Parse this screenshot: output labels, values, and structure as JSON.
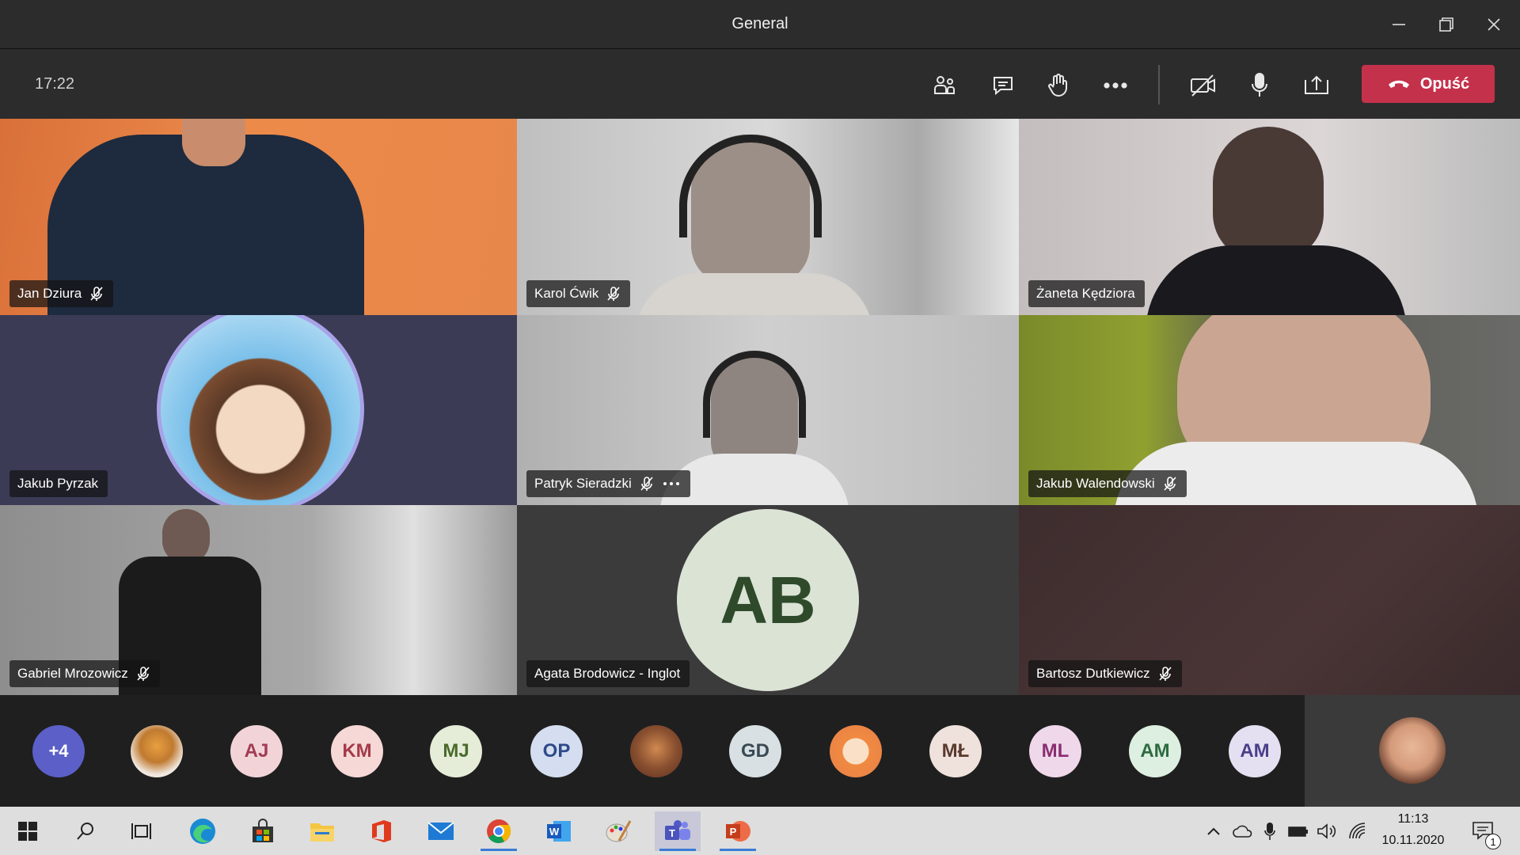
{
  "window": {
    "title": "General"
  },
  "toolbar": {
    "time": "17:22",
    "leave_label": "Opuść",
    "icons": [
      "participants-icon",
      "chat-icon",
      "raise-hand-icon",
      "more-icon",
      "camera-off-icon",
      "microphone-icon",
      "share-icon",
      "hang-up-icon"
    ],
    "leave_color": "#c4314b"
  },
  "tiles": [
    {
      "name": "Jan Dziura",
      "muted": true
    },
    {
      "name": "Karol Ćwik",
      "muted": true
    },
    {
      "name": "Żaneta Kędziora",
      "muted": false
    },
    {
      "name": "Jakub Pyrzak",
      "muted": false
    },
    {
      "name": "Patryk Sieradzki",
      "muted": true,
      "more": true
    },
    {
      "name": "Jakub Walendowski",
      "muted": true
    },
    {
      "name": "Gabriel Mrozowicz",
      "muted": true
    },
    {
      "name": "Agata Brodowicz - Inglot",
      "muted": false,
      "initials": "AB"
    },
    {
      "name": "Bartosz Dutkiewicz",
      "muted": true
    }
  ],
  "roster": {
    "overflow": "+4",
    "avatars": [
      {
        "initials": "",
        "kind": "photo"
      },
      {
        "initials": "AJ"
      },
      {
        "initials": "KM"
      },
      {
        "initials": "MJ"
      },
      {
        "initials": "OP"
      },
      {
        "initials": "",
        "kind": "photo"
      },
      {
        "initials": "GD"
      },
      {
        "initials": "",
        "kind": "photo"
      },
      {
        "initials": "MŁ"
      },
      {
        "initials": "ML"
      },
      {
        "initials": "AM"
      },
      {
        "initials": "AM"
      }
    ]
  },
  "taskbar": {
    "time": "11:13",
    "date": "10.11.2020",
    "notification_count": "1"
  }
}
